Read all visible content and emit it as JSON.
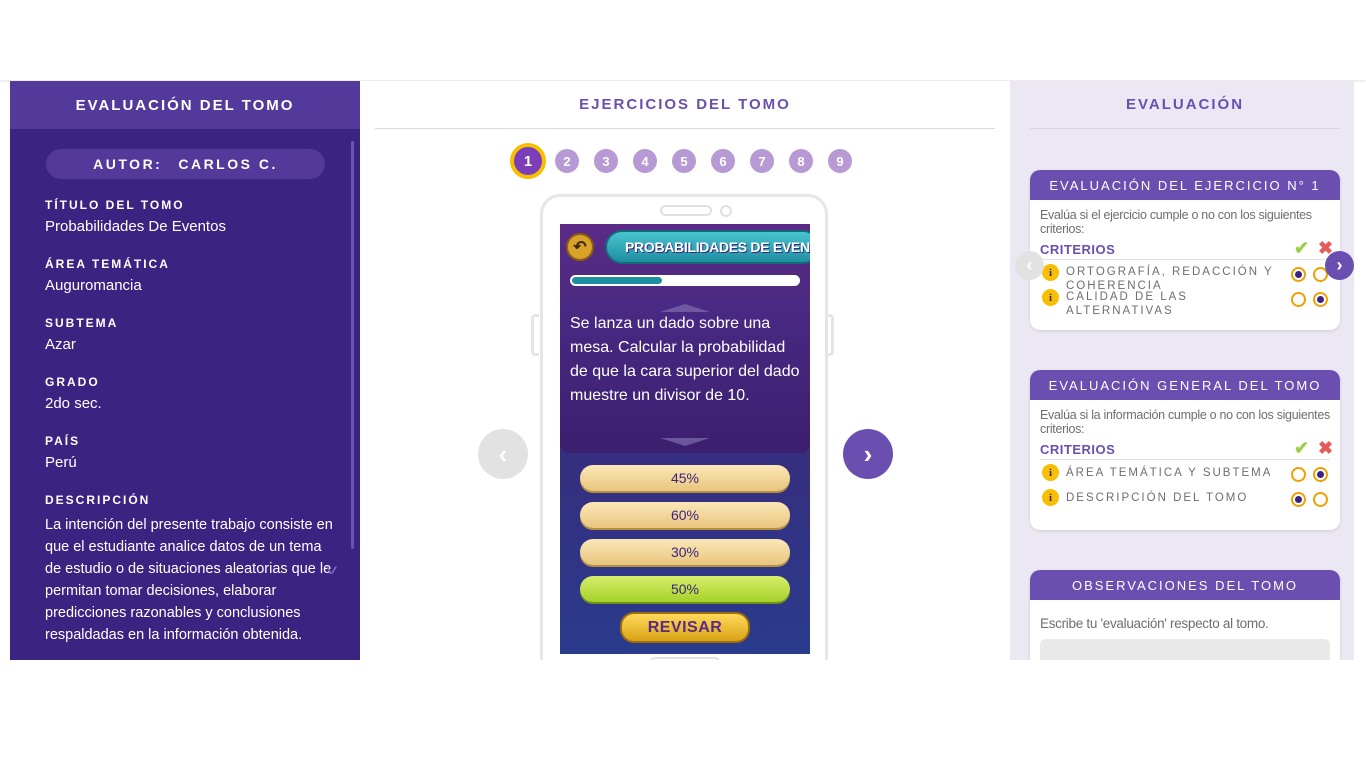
{
  "left": {
    "header": "EVALUACIÓN DEL TOMO",
    "author_label": "AUTOR:",
    "author_name": "CARLOS C.",
    "fields": [
      {
        "label": "TÍTULO DEL TOMO",
        "value": "Probabilidades De Eventos"
      },
      {
        "label": "ÁREA TEMÁTICA",
        "value": "Auguromancia"
      },
      {
        "label": "SUBTEMA",
        "value": "Azar"
      },
      {
        "label": "GRADO",
        "value": "2do sec."
      },
      {
        "label": "PAÍS",
        "value": "Perú"
      }
    ],
    "description_label": "DESCRIPCIÓN",
    "description": "La intención del presente trabajo consiste en que el estudiante analice datos de un tema de estudio o de situaciones aleatorias que le permitan tomar decisiones, elaborar predicciones razonables y conclusiones respaldadas en la información obtenida."
  },
  "center": {
    "header": "EJERCICIOS DEL TOMO",
    "exercise_numbers": [
      "1",
      "2",
      "3",
      "4",
      "5",
      "6",
      "7",
      "8",
      "9"
    ],
    "active_exercise": "1",
    "game": {
      "back_icon": "undo-arrow-icon",
      "title": "PROBABILIDADES DE EVENTOS",
      "progress": 0.4,
      "question": "Se lanza un dado sobre una mesa. Calcular la probabilidad de que la cara superior del dado muestre un divisor de 10.",
      "options": [
        "45%",
        "60%",
        "30%",
        "50%"
      ],
      "correct_option": "50%",
      "submit_label": "REVISAR"
    },
    "prev_icon": "chevron-left-icon",
    "next_icon": "chevron-right-icon"
  },
  "right": {
    "header": "EVALUACIÓN",
    "exercise_card": {
      "title": "EVALUACIÓN DEL EJERCICIO N° 1",
      "intro": "Evalúa si el ejercicio cumple o no con los siguientes criterios:",
      "criteria_label": "CRITERIOS",
      "items": [
        {
          "label": "ORTOGRAFÍA, REDACCIÓN Y COHERENCIA",
          "selected": "yes"
        },
        {
          "label": "CALIDAD DE LAS ALTERNATIVAS",
          "selected": "no"
        }
      ]
    },
    "general_card": {
      "title": "EVALUACIÓN GENERAL DEL TOMO",
      "intro": "Evalúa si la información cumple o no con los siguientes criterios:",
      "criteria_label": "CRITERIOS",
      "items": [
        {
          "label": "ÁREA TEMÁTICA Y SUBTEMA",
          "selected": "no"
        },
        {
          "label": "DESCRIPCIÓN DEL TOMO",
          "selected": "yes"
        }
      ]
    },
    "observations_card": {
      "title": "OBSERVACIONES DEL TOMO",
      "text": "Escribe tu 'evaluación' respecto al tomo."
    },
    "info_icon": "info-icon",
    "check_icon": "check-icon",
    "cross_icon": "cross-icon"
  },
  "colors": {
    "sidebar_bg": "#3b2381",
    "accent_purple": "#6a4fb0",
    "accent_yellow": "#f6c000",
    "right_panel_bg": "#ebe7f3"
  }
}
